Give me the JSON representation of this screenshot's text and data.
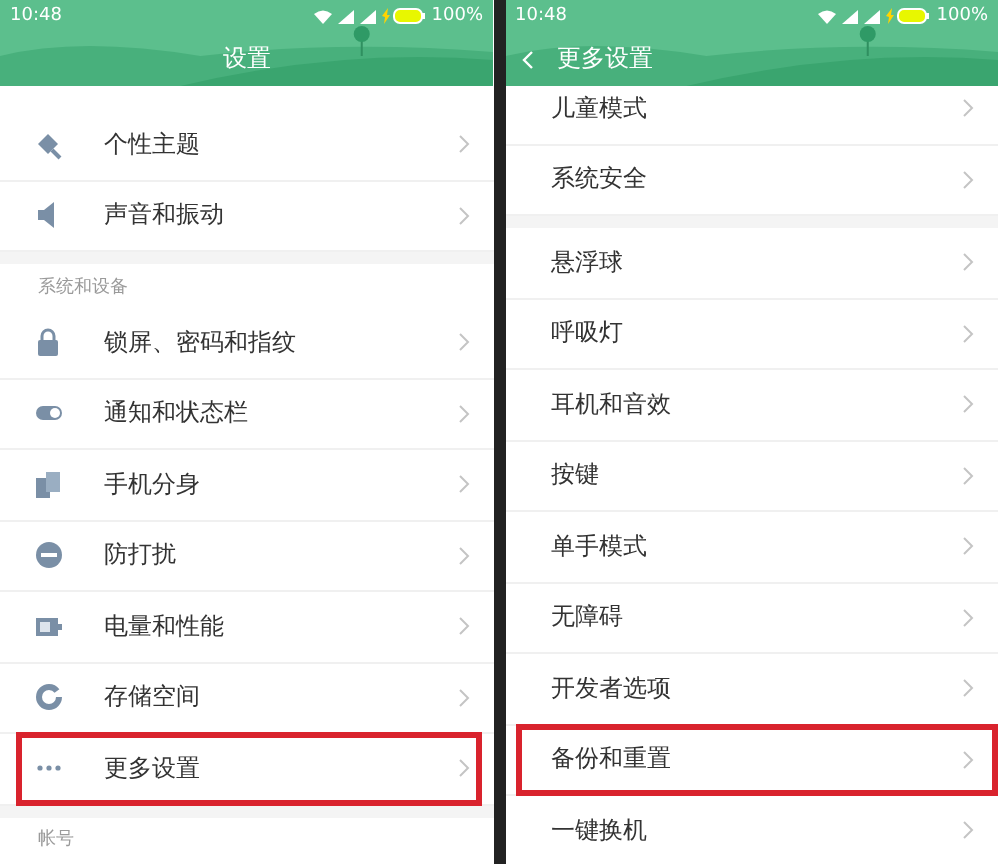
{
  "panels": [
    {
      "status_bar": {
        "time": "10:48",
        "battery": "100%"
      },
      "header": {
        "title": "设置",
        "back": false
      },
      "top_offset": false,
      "sections": [
        {
          "items": [
            {
              "label": "个性主题",
              "highlighted": false
            },
            {
              "label": "声音和振动",
              "highlighted": false
            }
          ]
        },
        {
          "header": "系统和设备",
          "items": [
            {
              "label": "锁屏、密码和指纹",
              "highlighted": false
            },
            {
              "label": "通知和状态栏",
              "highlighted": false
            },
            {
              "label": "手机分身",
              "highlighted": false
            },
            {
              "label": "防打扰",
              "highlighted": false
            },
            {
              "label": "电量和性能",
              "highlighted": false
            },
            {
              "label": "存储空间",
              "highlighted": false
            },
            {
              "label": "更多设置",
              "highlighted": true
            }
          ]
        },
        {
          "header": "帐号"
        }
      ]
    },
    {
      "status_bar": {
        "time": "10:48",
        "battery": "100%"
      },
      "header": {
        "title": "更多设置",
        "back": true
      },
      "top_offset": true,
      "sections": [
        {
          "items": [
            {
              "label": "儿童模式",
              "highlighted": false
            },
            {
              "label": "系统安全",
              "highlighted": false
            }
          ]
        },
        {
          "items": [
            {
              "label": "悬浮球",
              "highlighted": false
            },
            {
              "label": "呼吸灯",
              "highlighted": false
            },
            {
              "label": "耳机和音效",
              "highlighted": false
            },
            {
              "label": "按键",
              "highlighted": false
            },
            {
              "label": "单手模式",
              "highlighted": false
            },
            {
              "label": "无障碍",
              "highlighted": false
            },
            {
              "label": "开发者选项",
              "highlighted": false
            },
            {
              "label": "备份和重置",
              "highlighted": true
            },
            {
              "label": "一键换机",
              "highlighted": false
            }
          ]
        }
      ]
    }
  ]
}
